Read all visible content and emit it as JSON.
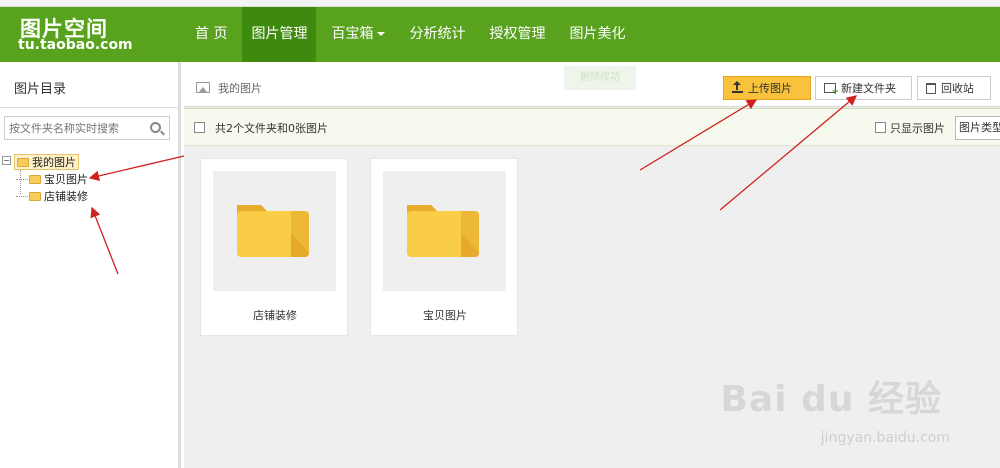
{
  "header": {
    "logo_title": "图片空间",
    "logo_domain": "tu.taobao.com",
    "nav": [
      "首 页",
      "图片管理",
      "百宝箱",
      "分析统计",
      "授权管理",
      "图片美化"
    ]
  },
  "sidebar": {
    "title": "图片目录",
    "search_placeholder": "按文件夹名称实时搜索",
    "tree": {
      "root": "我的图片",
      "children": [
        "宝贝图片",
        "店铺装修"
      ]
    }
  },
  "toolbar": {
    "breadcrumb": "我的图片",
    "toast": "删除成功",
    "upload_label": "上传图片",
    "newfolder_label": "新建文件夹",
    "recycle_label": "回收站"
  },
  "filter": {
    "summary": "共2个文件夹和0张图片",
    "only_images_label": "只显示图片",
    "type_select": "图片类型"
  },
  "folders": [
    {
      "name": "店铺装修"
    },
    {
      "name": "宝贝图片"
    }
  ],
  "watermark": {
    "brand": "Bai du 经验",
    "url": "jingyan.baidu.com"
  },
  "colors": {
    "header_green": "#58a21e",
    "active_nav": "#3e8a0e",
    "upload_yellow": "#f9c23c",
    "folder_yellow": "#f6c343",
    "annotation_red": "#d02020"
  }
}
